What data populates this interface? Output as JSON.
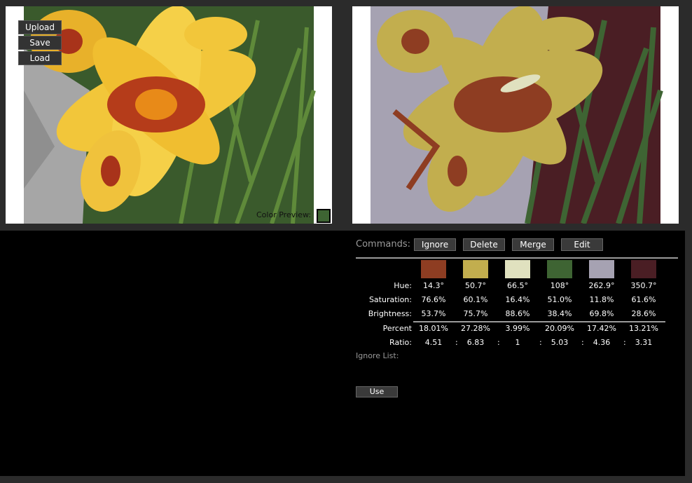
{
  "toolbar": {
    "upload_label": "Upload",
    "save_label": "Save",
    "load_label": "Load"
  },
  "color_preview": {
    "label": "Color Preview:",
    "color": "#3e6433"
  },
  "commands": {
    "label": "Commands:",
    "buttons": [
      "Ignore",
      "Delete",
      "Merge",
      "Edit"
    ]
  },
  "palette": {
    "colors": [
      "#8e3d22",
      "#c2ae4e",
      "#e0e1bf",
      "#3e6433",
      "#a6a2b2",
      "#4a1e24"
    ],
    "labels": {
      "hue": "Hue:",
      "saturation": "Saturation:",
      "brightness": "Brightness:",
      "percent": "Percent",
      "ratio": "Ratio:"
    },
    "hue": [
      "14.3°",
      "50.7°",
      "66.5°",
      "108°",
      "262.9°",
      "350.7°"
    ],
    "saturation": [
      "76.6%",
      "60.1%",
      "16.4%",
      "51.0%",
      "11.8%",
      "61.6%"
    ],
    "brightness": [
      "53.7%",
      "75.7%",
      "88.6%",
      "38.4%",
      "69.8%",
      "28.6%"
    ],
    "percent": [
      "18.01%",
      "27.28%",
      "3.99%",
      "20.09%",
      "17.42%",
      "13.21%"
    ],
    "ratio": [
      "4.51",
      "6.83",
      "1",
      "5.03",
      "4.36",
      "3.31"
    ],
    "ratio_sep": ":"
  },
  "ignore_list": {
    "label": "Ignore List:"
  },
  "use_button": {
    "label": "Use"
  }
}
